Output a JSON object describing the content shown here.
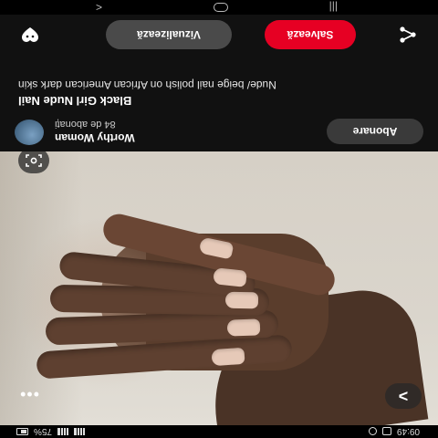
{
  "status_bar": {
    "time": "09:49",
    "battery": "75%",
    "icons": [
      "alarm-icon",
      "notification-icon",
      "signal-icon",
      "wifi-icon",
      "battery-icon"
    ]
  },
  "navigation": {
    "recents": "|||",
    "back": "<"
  },
  "image": {
    "next_label": ">",
    "more_label": "•••",
    "lens_icon": "visual-search-icon"
  },
  "creator": {
    "name": "Worthy Woman",
    "followers": "84 de abonați",
    "follow_label": "Abonare"
  },
  "pin": {
    "title": "Black Girl Nude Nail",
    "description": "Nude/ beige nail polish on African American dark skin"
  },
  "actions": {
    "visit_label": "Vizualizează",
    "save_label": "Salvează",
    "save_color": "#e60023",
    "react_icon": "reaction-icon",
    "share_icon": "share-icon"
  }
}
